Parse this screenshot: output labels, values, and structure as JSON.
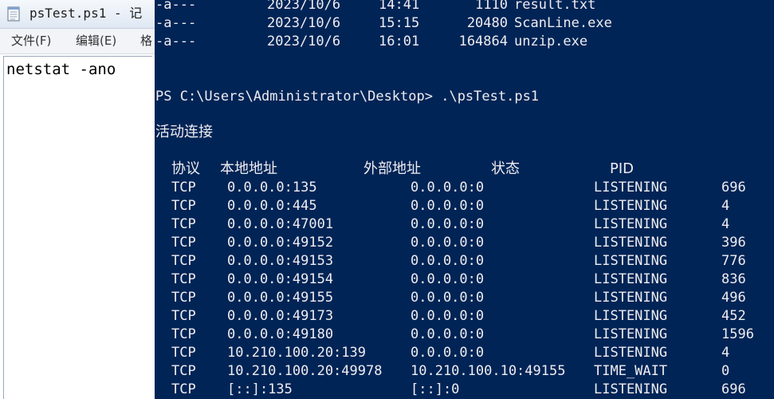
{
  "notepad": {
    "title": "psTest.ps1 - 记",
    "menu": [
      "文件(F)",
      "编辑(E)",
      "格"
    ],
    "content": "netstat -ano"
  },
  "console": {
    "file_listing": [
      {
        "mode": "-a---",
        "date": "2023/10/6",
        "time": "14:41",
        "length": "1110",
        "name": "result.txt"
      },
      {
        "mode": "-a---",
        "date": "2023/10/6",
        "time": "15:15",
        "length": "20480",
        "name": "ScanLine.exe"
      },
      {
        "mode": "-a---",
        "date": "2023/10/6",
        "time": "16:01",
        "length": "164864",
        "name": "unzip.exe"
      }
    ],
    "prompt": "PS C:\\Users\\Administrator\\Desktop> .\\psTest.ps1",
    "section_title": "活动连接",
    "columns": [
      "协议",
      "本地地址",
      "外部地址",
      "状态",
      "PID"
    ],
    "connections": [
      {
        "proto": "TCP",
        "local": "0.0.0.0:135",
        "foreign": "0.0.0.0:0",
        "state": "LISTENING",
        "pid": "696"
      },
      {
        "proto": "TCP",
        "local": "0.0.0.0:445",
        "foreign": "0.0.0.0:0",
        "state": "LISTENING",
        "pid": "4"
      },
      {
        "proto": "TCP",
        "local": "0.0.0.0:47001",
        "foreign": "0.0.0.0:0",
        "state": "LISTENING",
        "pid": "4"
      },
      {
        "proto": "TCP",
        "local": "0.0.0.0:49152",
        "foreign": "0.0.0.0:0",
        "state": "LISTENING",
        "pid": "396"
      },
      {
        "proto": "TCP",
        "local": "0.0.0.0:49153",
        "foreign": "0.0.0.0:0",
        "state": "LISTENING",
        "pid": "776"
      },
      {
        "proto": "TCP",
        "local": "0.0.0.0:49154",
        "foreign": "0.0.0.0:0",
        "state": "LISTENING",
        "pid": "836"
      },
      {
        "proto": "TCP",
        "local": "0.0.0.0:49155",
        "foreign": "0.0.0.0:0",
        "state": "LISTENING",
        "pid": "496"
      },
      {
        "proto": "TCP",
        "local": "0.0.0.0:49173",
        "foreign": "0.0.0.0:0",
        "state": "LISTENING",
        "pid": "452"
      },
      {
        "proto": "TCP",
        "local": "0.0.0.0:49180",
        "foreign": "0.0.0.0:0",
        "state": "LISTENING",
        "pid": "1596"
      },
      {
        "proto": "TCP",
        "local": "10.210.100.20:139",
        "foreign": "0.0.0.0:0",
        "state": "LISTENING",
        "pid": "4"
      },
      {
        "proto": "TCP",
        "local": "10.210.100.20:49978",
        "foreign": "10.210.100.10:49155",
        "state": "TIME_WAIT",
        "pid": "0"
      },
      {
        "proto": "TCP",
        "local": "[::]:135",
        "foreign": "[::]:0",
        "state": "LISTENING",
        "pid": "696"
      }
    ]
  },
  "colors": {
    "console_background": "#012456",
    "console_text": "#eeedf0",
    "notepad_background": "#ffffff"
  },
  "icons": {
    "notepad_app": "notepad-icon"
  }
}
